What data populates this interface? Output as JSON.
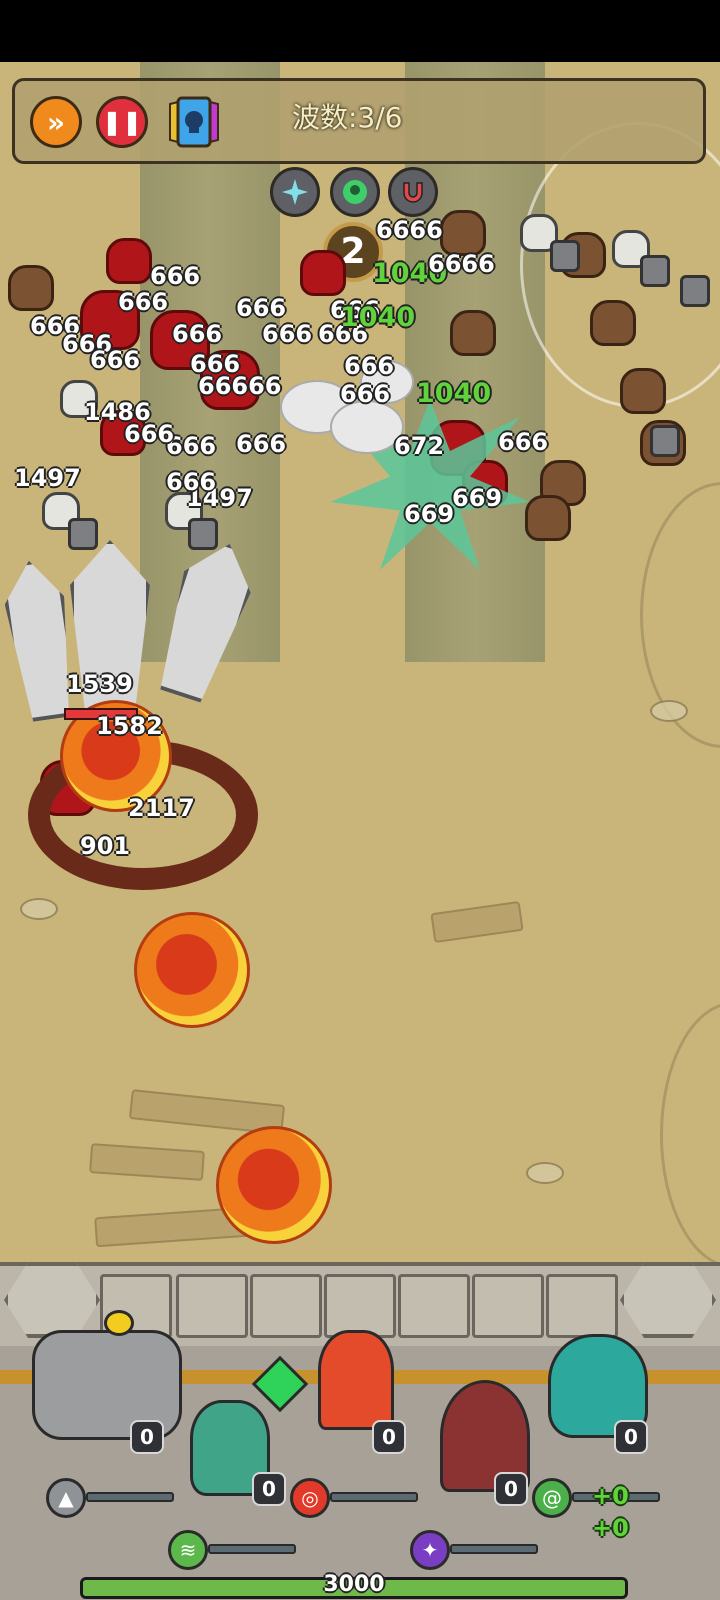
{
  "hud": {
    "wave_text": "波数:3/6",
    "wave_counter": "2",
    "fast_forward_icon": "fast-forward-icon",
    "pause_icon": "pause-icon",
    "collection_icon": "skull-card-icon",
    "buffs": [
      "sparkle-buff-icon",
      "ghost-buff-icon",
      "magnet-buff-icon"
    ]
  },
  "damage_numbers": [
    "666",
    "666",
    "666",
    "666",
    "666",
    "666",
    "666",
    "666",
    "666",
    "666",
    "666",
    "666",
    "666",
    "1486",
    "1497",
    "1497",
    "672",
    "669",
    "669",
    "666",
    "666",
    "66666",
    "1040",
    "1040",
    "1040",
    "1539",
    "1582",
    "2117",
    "901",
    "6666",
    "666",
    "666",
    "666",
    "6666"
  ],
  "heroes": [
    {
      "name": "stone-golem",
      "count": "0",
      "skill_icon": "rock-spikes-icon",
      "fill": 0.0
    },
    {
      "name": "green-bird-druid",
      "count": "0",
      "skill_icon": "tornado-icon",
      "fill": 0.0
    },
    {
      "name": "fire-mage",
      "count": "0",
      "skill_icon": "fire-target-icon",
      "fill": 0.0
    },
    {
      "name": "hooded-warlock",
      "count": "0",
      "skill_icon": "constellation-icon",
      "fill": 0.0
    },
    {
      "name": "water-spirit",
      "count": "0",
      "skill_icon": "whirlpool-icon",
      "fill": 0.0
    }
  ],
  "bonus_texts": [
    "+0",
    "+0"
  ],
  "base_hp": "3000",
  "base_hp_fill": 1.0,
  "colors": {
    "accent_orange": "#f08a1c",
    "pause_red": "#e0303d",
    "hp_green": "#6fb84a",
    "skill_blue": "#6ac6ec"
  }
}
